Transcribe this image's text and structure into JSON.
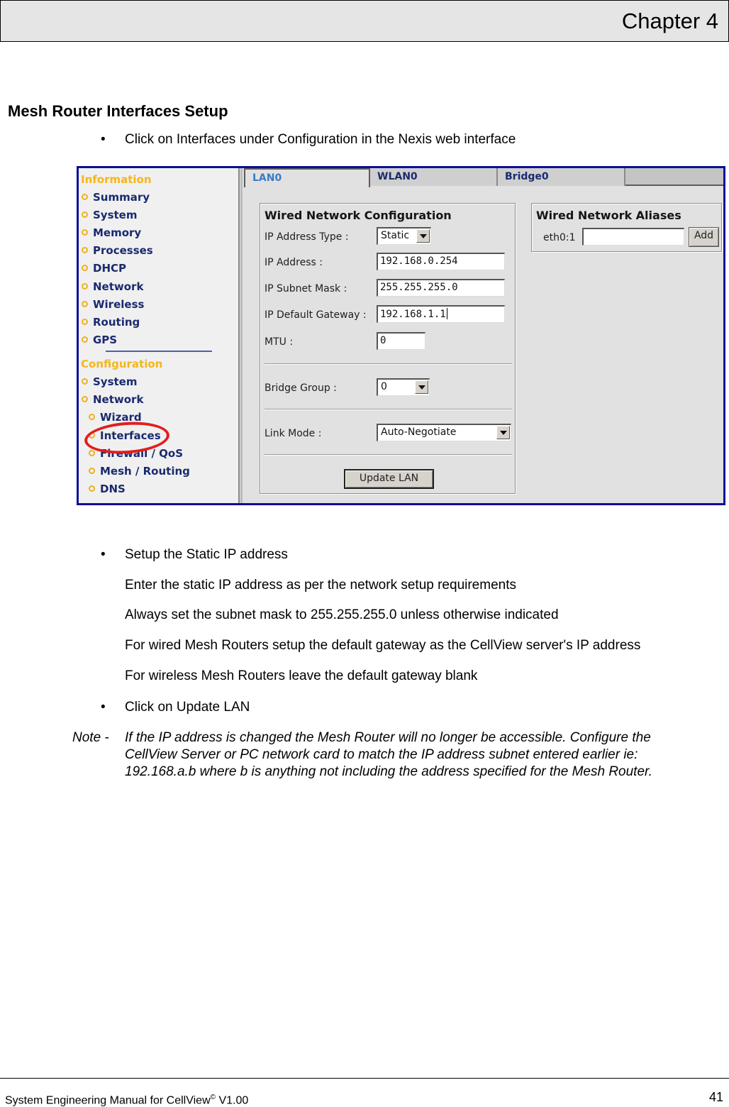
{
  "header": {
    "chapter": "Chapter 4"
  },
  "section": {
    "title": "Mesh Router Interfaces Setup",
    "bullet_symbol": "•",
    "intro_bullet": "Click on Interfaces under Configuration in the Nexis web interface",
    "setup_bullet": "Setup the Static IP address",
    "setup_details": [
      "Enter the static IP address as per the network setup requirements",
      "Always set the subnet mask to 255.255.255.0 unless otherwise indicated",
      "For wired Mesh Routers setup the default gateway as the CellView server's IP address",
      "For wireless Mesh Routers leave the default gateway blank"
    ],
    "update_bullet": "Click on Update LAN",
    "note": {
      "label": "Note -",
      "lines": [
        "If the IP address is changed the Mesh Router will no longer be accessible.  Configure the",
        "CellView Server or PC network card to match the IP address subnet entered earlier  ie:",
        "192.168.a.b where b is anything not including the address specified for the Mesh Router."
      ]
    }
  },
  "screenshot": {
    "sidebar": {
      "information_heading": "Information",
      "information_items": [
        "Summary",
        "System",
        "Memory",
        "Processes",
        "DHCP",
        "Network",
        "Wireless",
        "Routing",
        "GPS"
      ],
      "configuration_heading": "Configuration",
      "configuration_items": [
        "System",
        "Network"
      ],
      "network_subitems": [
        "Wizard",
        "Interfaces",
        "Firewall / QoS",
        "Mesh / Routing",
        "DNS"
      ],
      "highlighted_item": "Interfaces",
      "heading_color": "#f3b61e",
      "item_color": "#1a2a6e",
      "highlight_color": "#e31d1d"
    },
    "tabs": [
      {
        "label": "LAN0",
        "active": true
      },
      {
        "label": "WLAN0",
        "active": false
      },
      {
        "label": "Bridge0",
        "active": false
      }
    ],
    "wired_config": {
      "title": "Wired Network Configuration",
      "ip_type_label": "IP Address Type :",
      "ip_type_value": "Static",
      "ip_address_label": "IP Address :",
      "ip_address_value": "192.168.0.254",
      "subnet_label": "IP Subnet Mask :",
      "subnet_value": "255.255.255.0",
      "gateway_label": "IP Default Gateway :",
      "gateway_value": "192.168.1.1",
      "mtu_label": "MTU :",
      "mtu_value": "0",
      "bridge_label": "Bridge Group :",
      "bridge_value": "0",
      "link_label": "Link Mode :",
      "link_value": "Auto-Negotiate",
      "update_button": "Update LAN"
    },
    "aliases": {
      "title": "Wired Network Aliases",
      "alias_label": "eth0:1",
      "alias_value": "",
      "add_button": "Add"
    },
    "frame_color": "#0b0f94"
  },
  "footer": {
    "manual_title": "System Engineering Manual for CellView",
    "registered_mark": "©",
    "version": " V1.00",
    "page_number": "41"
  }
}
